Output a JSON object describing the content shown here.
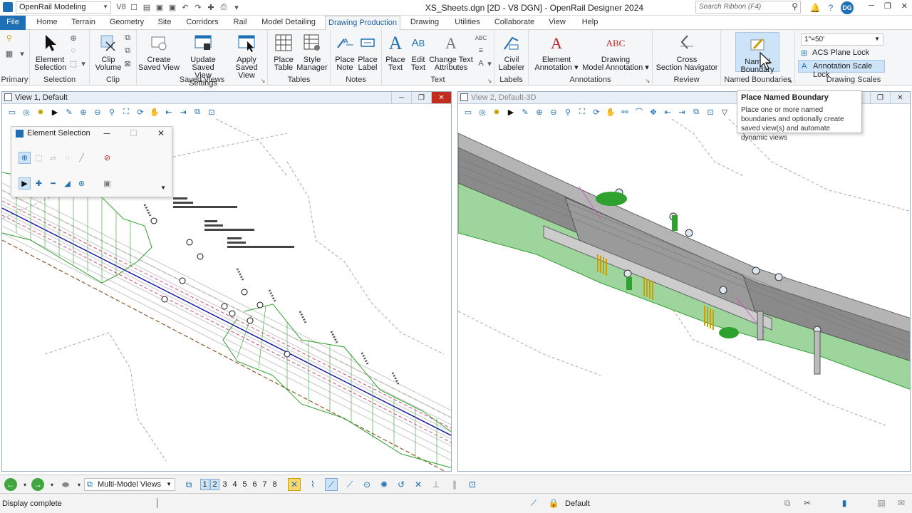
{
  "titlebar": {
    "workspace": "OpenRail Modeling",
    "title": "XS_Sheets.dgn [2D - V8 DGN] - OpenRail Designer 2024",
    "search_placeholder": "Search Ribbon (F4)",
    "user_initials": "DG"
  },
  "tabs": [
    "File",
    "Home",
    "Terrain",
    "Geometry",
    "Site",
    "Corridors",
    "Rail",
    "Model Detailing",
    "Drawing Production",
    "Drawing",
    "Utilities",
    "Collaborate",
    "View",
    "Help"
  ],
  "ribbon": {
    "groups": {
      "primary": "Primary",
      "selection": "Selection",
      "clip": "Clip",
      "saved_views": "Saved Views",
      "tables": "Tables",
      "notes": "Notes",
      "text": "Text",
      "labels": "Labels",
      "annotations": "Annotations",
      "review": "Review",
      "named_boundaries": "Named Boundaries",
      "drawing_scales": "Drawing Scales"
    },
    "buttons": {
      "element_selection": [
        "Element",
        "Selection"
      ],
      "clip_volume": [
        "Clip",
        "Volume"
      ],
      "create_saved_view": [
        "Create",
        "Saved View"
      ],
      "update_saved_view": [
        "Update Saved",
        "View Settings"
      ],
      "apply_saved_view": [
        "Apply",
        "Saved View"
      ],
      "place_table": [
        "Place",
        "Table"
      ],
      "style_manager": [
        "Style",
        "Manager"
      ],
      "place_note": [
        "Place",
        "Note"
      ],
      "place_label": [
        "Place",
        "Label"
      ],
      "place_text": [
        "Place",
        "Text"
      ],
      "edit_text": [
        "Edit",
        "Text"
      ],
      "change_text_attributes": [
        "Change Text",
        "Attributes"
      ],
      "civil_labeler": [
        "Civil",
        "Labeler"
      ],
      "element_annotation": [
        "Element",
        "Annotation"
      ],
      "drawing_model_annotation": [
        "Drawing",
        "Model Annotation"
      ],
      "cross_section_navigator": [
        "Cross",
        "Section Navigator"
      ],
      "named_boundary": [
        "Named",
        "Boundary"
      ]
    },
    "scale_value": "1\"=50'",
    "acs_plane_lock": "ACS Plane Lock",
    "annotation_scale_lock": "Annotation Scale Lock"
  },
  "views": {
    "view1_title": "View 1, Default",
    "view2_title": "View 2, Default-3D"
  },
  "element_selection_dialog": {
    "title": "Element Selection"
  },
  "tooltip": {
    "title": "Place Named Boundary",
    "description": "Place one or more named boundaries and optionally create saved view(s) and automate dynamic views"
  },
  "bottombar": {
    "model_views": "Multi-Model Views",
    "view_numbers": [
      "1",
      "2",
      "3",
      "4",
      "5",
      "6",
      "7",
      "8"
    ]
  },
  "status": {
    "message": "Display complete",
    "level": "Default"
  },
  "colors": {
    "accent": "#1f6fb4",
    "corridor_green": "#2ea12e",
    "alignment_blue": "#1a1aa8",
    "close_red": "#c42b1c"
  }
}
